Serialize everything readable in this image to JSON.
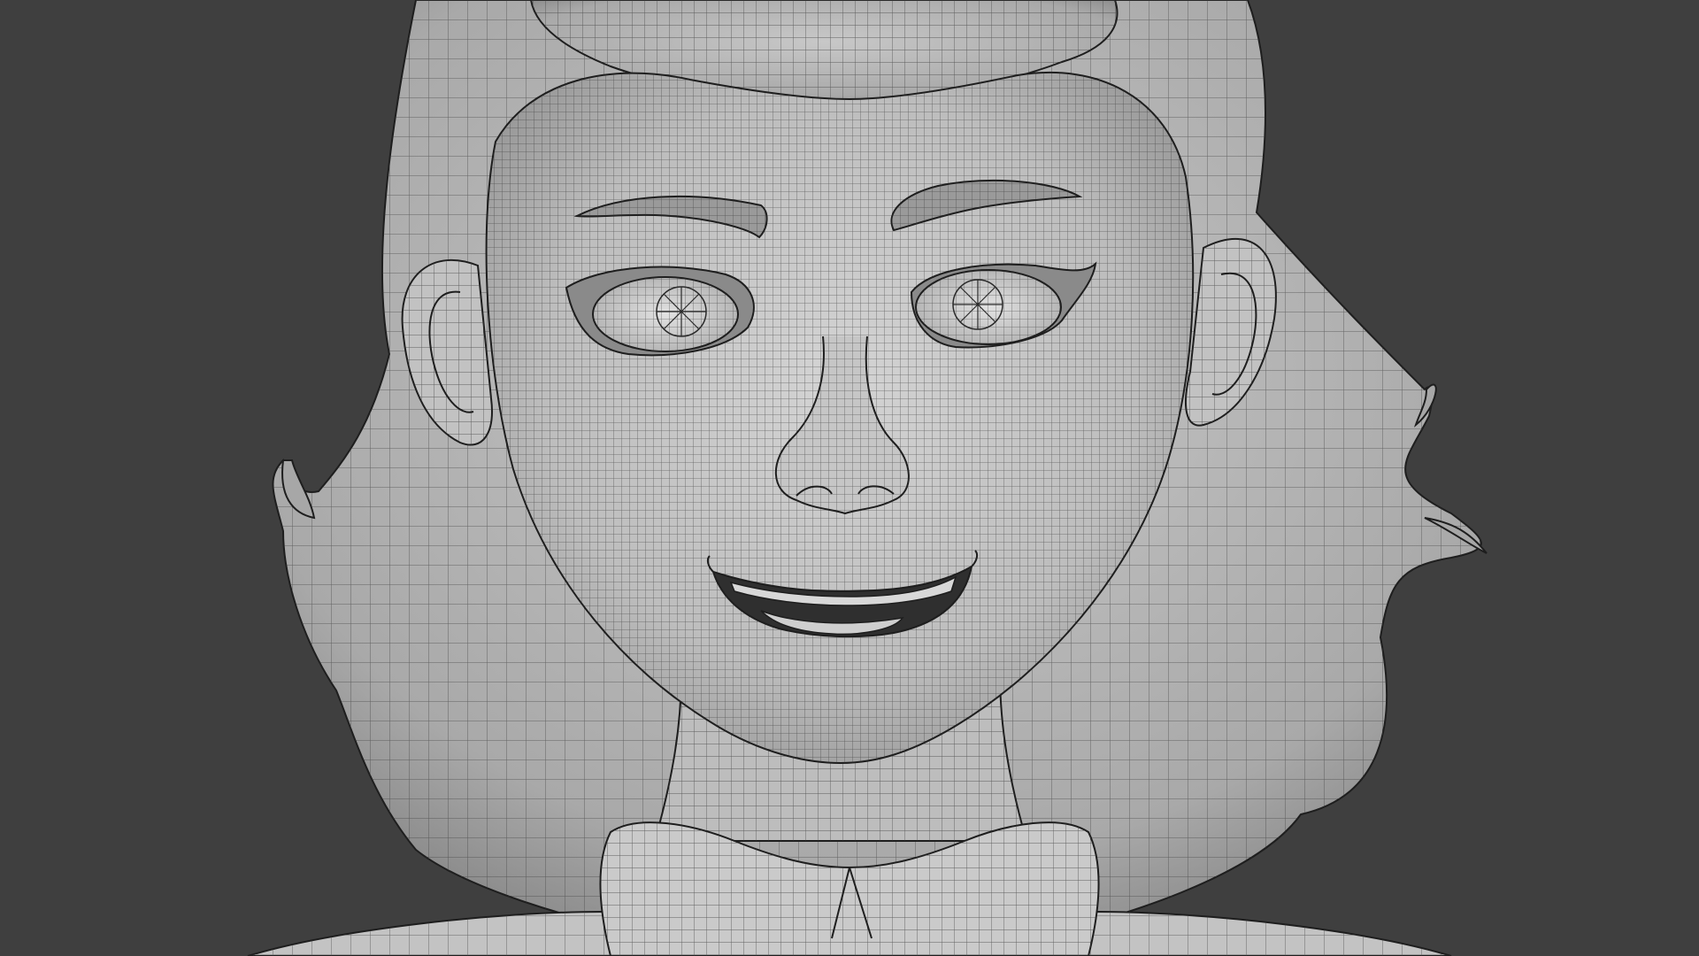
{
  "viewport": {
    "background_color": "#3f3f3f",
    "shading": "solid-wireframe-overlay",
    "subject": "stylized-female-head-bust-mesh"
  },
  "colors": {
    "mesh_fill_light": "#cfcfcf",
    "mesh_fill_mid": "#b9b9b9",
    "mesh_fill_dark": "#8e8e8e",
    "wire_color": "#3a3a3a",
    "outline_color": "#1e1e1e"
  }
}
